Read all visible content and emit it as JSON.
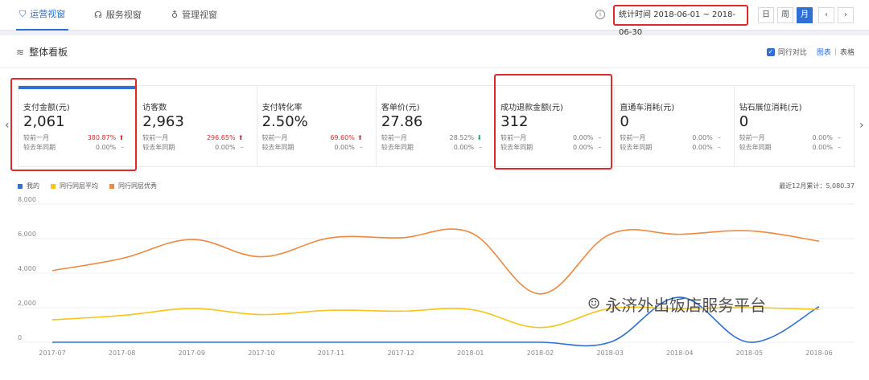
{
  "topnav": {
    "tabs": [
      {
        "label": "运营视窗",
        "icon": "shield-icon",
        "active": true
      },
      {
        "label": "服务视窗",
        "icon": "headset-icon",
        "active": false
      },
      {
        "label": "管理视窗",
        "icon": "medal-icon",
        "active": false
      }
    ],
    "date_range": "统计时间 2018-06-01 ~ 2018-06-30",
    "period_buttons": [
      "日",
      "周",
      "月"
    ],
    "active_period": "月",
    "prev": "‹",
    "next": "›"
  },
  "section": {
    "title": "整体看板",
    "compare_label": "同行对比",
    "view_chart": "图表",
    "view_sep": "|",
    "view_table": "表格"
  },
  "cards": [
    {
      "label": "支付金额(元)",
      "value": "2,061",
      "mom_label": "较前一月",
      "mom": "380.87%",
      "mom_dir": "up",
      "yoy_label": "较去年同期",
      "yoy": "0.00%",
      "yoy_dir": "flat"
    },
    {
      "label": "访客数",
      "value": "2,963",
      "mom_label": "较前一月",
      "mom": "296.65%",
      "mom_dir": "up",
      "yoy_label": "较去年同期",
      "yoy": "0.00%",
      "yoy_dir": "flat"
    },
    {
      "label": "支付转化率",
      "value": "2.50%",
      "mom_label": "较前一月",
      "mom": "69.60%",
      "mom_dir": "up",
      "yoy_label": "较去年同期",
      "yoy": "0.00%",
      "yoy_dir": "flat"
    },
    {
      "label": "客单价(元)",
      "value": "27.86",
      "mom_label": "较前一月",
      "mom": "28.52%",
      "mom_dir": "down",
      "yoy_label": "较去年同期",
      "yoy": "0.00%",
      "yoy_dir": "flat"
    },
    {
      "label": "成功退款金额(元)",
      "value": "312",
      "mom_label": "较前一月",
      "mom": "0.00%",
      "mom_dir": "flat",
      "yoy_label": "较去年同期",
      "yoy": "0.00%",
      "yoy_dir": "flat"
    },
    {
      "label": "直通车消耗(元)",
      "value": "0",
      "mom_label": "较前一月",
      "mom": "0.00%",
      "mom_dir": "flat",
      "yoy_label": "较去年同期",
      "yoy": "0.00%",
      "yoy_dir": "flat"
    },
    {
      "label": "钻石展位消耗(元)",
      "value": "0",
      "mom_label": "较前一月",
      "mom": "0.00%",
      "mom_dir": "flat",
      "yoy_label": "较去年同期",
      "yoy": "0.00%",
      "yoy_dir": "flat"
    }
  ],
  "annual_total": "最近12月累计：5,080.37",
  "watermark": "永济外出饭店服务平台",
  "colors": {
    "accent": "#2f6fd6",
    "highlight": "#e0292c",
    "mine": "#2f6fd6",
    "avg": "#f5c518",
    "excellent": "#f0883e"
  },
  "chart_data": {
    "type": "line",
    "categories": [
      "2017-07",
      "2017-08",
      "2017-09",
      "2017-10",
      "2017-11",
      "2017-12",
      "2018-01",
      "2018-02",
      "2018-03",
      "2018-04",
      "2018-05",
      "2018-06"
    ],
    "series": [
      {
        "name": "我的",
        "values": [
          0,
          0,
          0,
          0,
          0,
          0,
          0,
          0,
          0,
          2600,
          0,
          2061
        ]
      },
      {
        "name": "同行同层平均",
        "values": [
          1300,
          1550,
          1950,
          1600,
          1850,
          1800,
          1900,
          850,
          1950,
          1950,
          2000,
          1900
        ]
      },
      {
        "name": "同行同层优秀",
        "values": [
          4150,
          4850,
          5950,
          4950,
          6050,
          6050,
          6350,
          2800,
          6250,
          6250,
          6450,
          5850
        ]
      }
    ],
    "yticks": [
      "0",
      "2,000",
      "4,000",
      "6,000",
      "8,000"
    ],
    "ylim": [
      0,
      8000
    ],
    "grid": true,
    "legend": "top-left"
  }
}
